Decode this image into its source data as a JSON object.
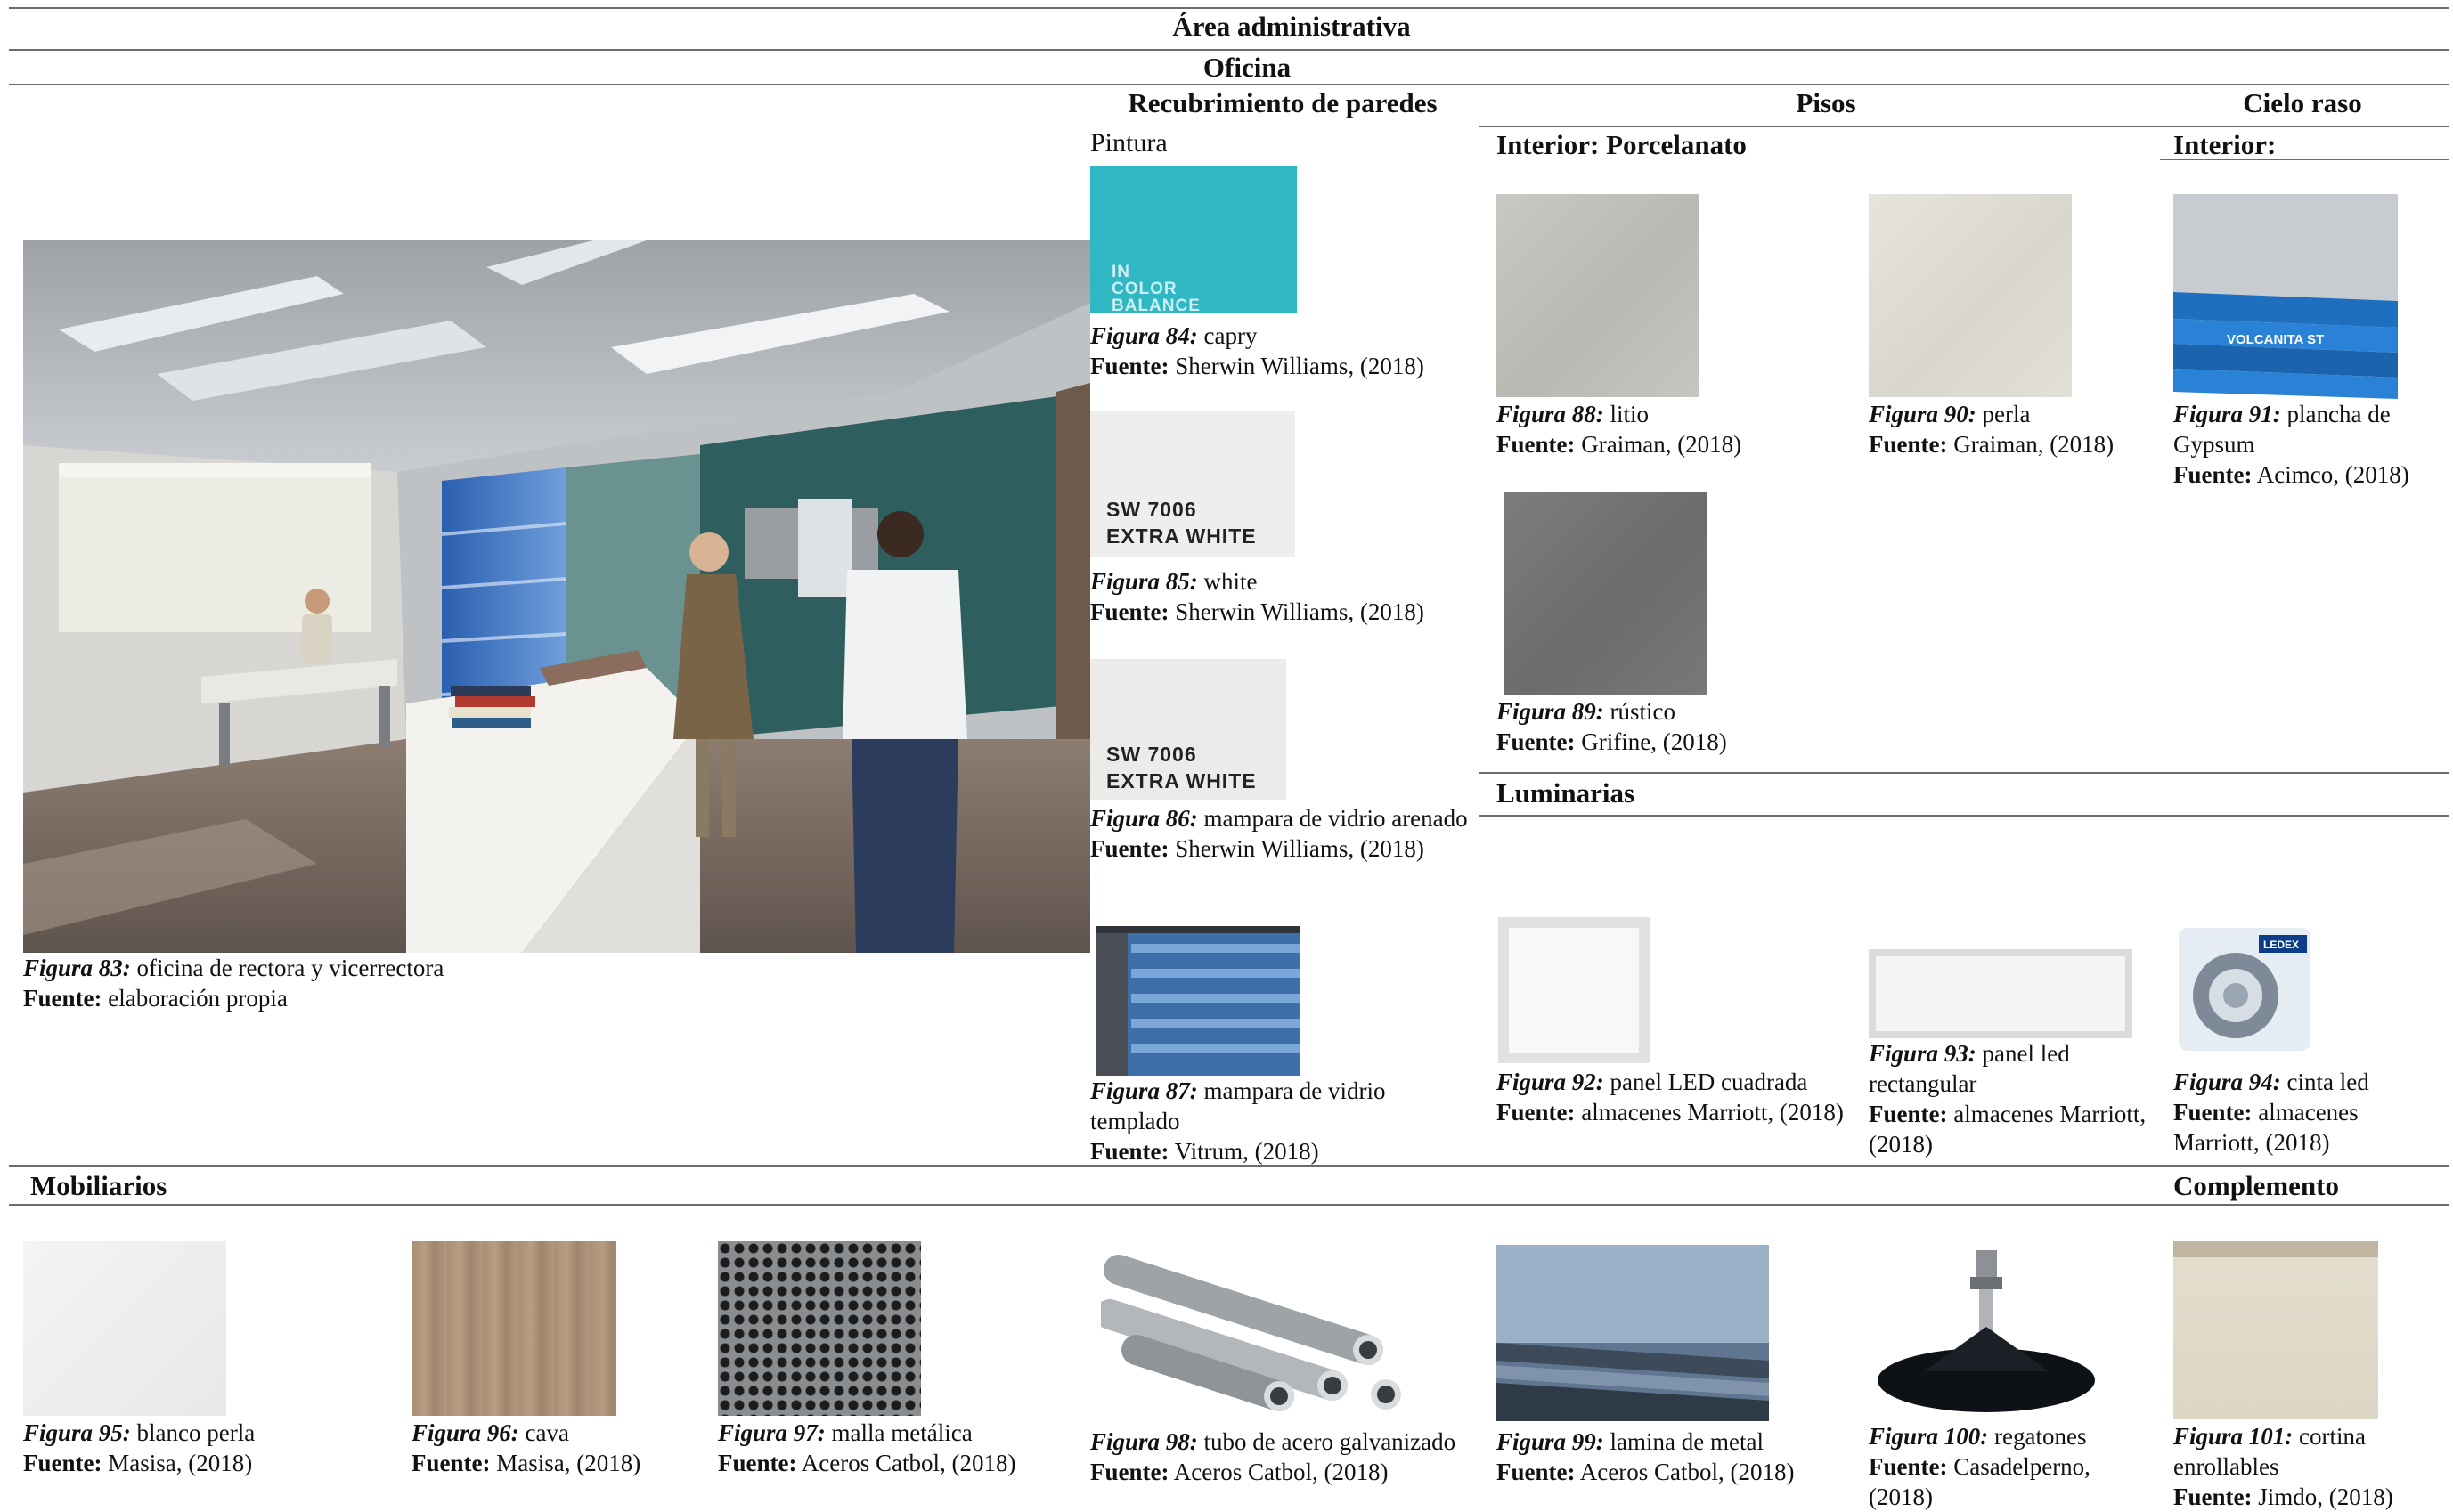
{
  "headers": {
    "area": "Área administrativa",
    "space": "Oficina",
    "walls": "Recubrimiento de paredes",
    "floors": "Pisos",
    "ceiling": "Cielo raso",
    "paint": "Pintura",
    "floor_interior": "Interior: Porcelanato",
    "ceiling_interior": "Interior:",
    "lights": "Luminarias",
    "furniture": "Mobiliarios",
    "complement": "Complemento"
  },
  "swatch_labels": {
    "in_color": "IN",
    "color": "COLOR",
    "balance": "BALANCE",
    "sw_code_1": "SW 7006",
    "sw_name_1": "EXTRA WHITE",
    "sw_code_2": "SW 7006",
    "sw_name_2": "EXTRA WHITE",
    "ledex": "LEDEX",
    "volcan": "VOLCANITA ST"
  },
  "figures": {
    "f83": {
      "label": "Figura 83:",
      "desc": "oficina de rectora y vicerrectora",
      "src_label": "Fuente:",
      "src": "elaboración propia"
    },
    "f84": {
      "label": "Figura 84:",
      "desc": "capry",
      "src_label": "Fuente:",
      "src": "Sherwin Williams, (2018)"
    },
    "f85": {
      "label": "Figura 85:",
      "desc": "white",
      "src_label": "Fuente:",
      "src": "Sherwin Williams, (2018)"
    },
    "f86": {
      "label": "Figura 86:",
      "desc": "mampara de vidrio arenado",
      "src_label": "Fuente:",
      "src": "Sherwin Williams, (2018)"
    },
    "f87": {
      "label": "Figura 87:",
      "desc": "mampara de vidrio templado",
      "src_label": "Fuente:",
      "src": "Vitrum, (2018)"
    },
    "f88": {
      "label": "Figura 88:",
      "desc": "litio",
      "src_label": "Fuente:",
      "src": "Graiman, (2018)"
    },
    "f89": {
      "label": "Figura 89:",
      "desc": "rústico",
      "src_label": "Fuente:",
      "src": "Grifine, (2018)"
    },
    "f90": {
      "label": "Figura 90:",
      "desc": "perla",
      "src_label": "Fuente:",
      "src": "Graiman, (2018)"
    },
    "f91": {
      "label": "Figura 91:",
      "desc": "plancha de Gypsum",
      "src_label": "Fuente:",
      "src": "Acimco, (2018)"
    },
    "f92": {
      "label": "Figura 92:",
      "desc": "panel LED cuadrada",
      "src_label": "Fuente:",
      "src": "almacenes Marriott, (2018)"
    },
    "f93": {
      "label": "Figura 93:",
      "desc": "panel led rectangular",
      "src_label": "Fuente:",
      "src": "almacenes Marriott, (2018)"
    },
    "f94": {
      "label": "Figura 94:",
      "desc": "cinta led",
      "src_label": "Fuente:",
      "src": "almacenes Marriott, (2018)"
    },
    "f95": {
      "label": "Figura 95:",
      "desc": "blanco perla",
      "src_label": "Fuente:",
      "src": "Masisa, (2018)"
    },
    "f96": {
      "label": "Figura 96:",
      "desc": "cava",
      "src_label": "Fuente:",
      "src": "Masisa, (2018)"
    },
    "f97": {
      "label": "Figura 97:",
      "desc": "malla metálica",
      "src_label": "Fuente:",
      "src": "Aceros Catbol, (2018)"
    },
    "f98": {
      "label": "Figura 98:",
      "desc": "tubo de acero galvanizado",
      "src_label": "Fuente:",
      "src": "Aceros Catbol, (2018)"
    },
    "f99": {
      "label": "Figura 99:",
      "desc": "lamina de metal",
      "src_label": "Fuente:",
      "src": "Aceros Catbol, (2018)"
    },
    "f100": {
      "label": "Figura 100:",
      "desc": "regatones",
      "src_label": "Fuente:",
      "src": "Casadelperno, (2018)"
    },
    "f101": {
      "label": "Figura 101:",
      "desc": "cortina enrollables",
      "src_label": "Fuente:",
      "src": "Jimdo, (2018)"
    }
  },
  "colors": {
    "capry": "#2fb7c4",
    "extra_white": "#eeefec",
    "rule": "#6b6b6b",
    "teal_wall": "#2f5e5f"
  }
}
